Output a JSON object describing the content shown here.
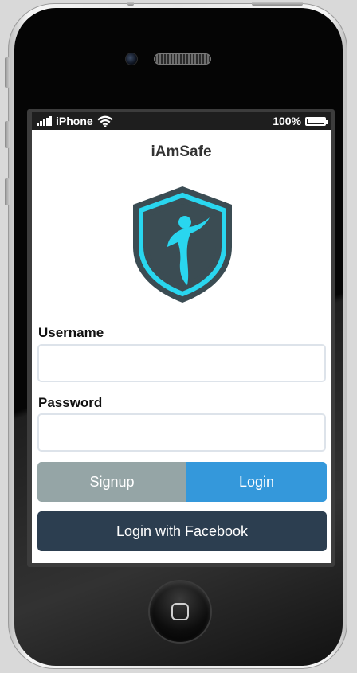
{
  "status_bar": {
    "carrier": "iPhone",
    "battery": "100%",
    "icons": [
      "signal-bars-icon",
      "wifi-icon",
      "battery-icon"
    ]
  },
  "app": {
    "title": "iAmSafe",
    "logo": "shield-person-logo"
  },
  "form": {
    "username_label": "Username",
    "username_value": "",
    "password_label": "Password",
    "password_value": ""
  },
  "buttons": {
    "signup": "Signup",
    "login": "Login",
    "facebook": "Login with Facebook"
  },
  "colors": {
    "signup": "#95a5a6",
    "login": "#3498db",
    "facebook": "#2c3e50",
    "shield_accent": "#29d6ef",
    "shield_body": "#3b4c53"
  }
}
